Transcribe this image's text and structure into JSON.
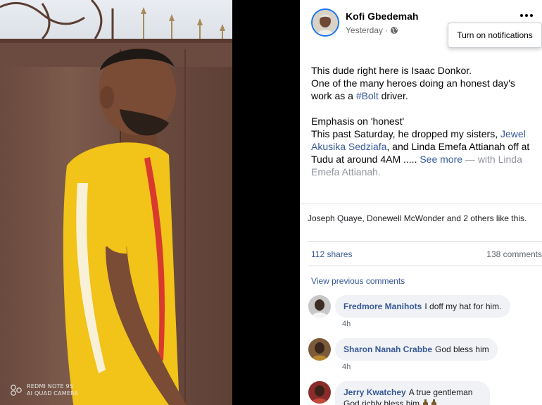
{
  "photo": {
    "watermark_line1": "REDMI NOTE 9S",
    "watermark_line2": "AI QUAD CAMERA"
  },
  "post": {
    "author": "Kofi Gbedemah",
    "time": "Yesterday",
    "audience_icon": "globe-icon",
    "tooltip": "Turn on notifications",
    "text_line1": "This dude right here is Isaac Donkor.",
    "text_line2_a": "One of the many heroes doing an honest day's work as a ",
    "hashtag": "#Bolt",
    "text_line2_b": " driver.",
    "text_line3": "Emphasis on 'honest'",
    "text_line4_a": "This past Saturday, he dropped my sisters, ",
    "tag1": "Jewel Akusika Sedziafa",
    "text_line4_b": ", and Linda Emefa Attianah off at Tudu at around 4AM ..... ",
    "see_more": "See more",
    "with_text": " — with Linda Emefa Attianah."
  },
  "reactions": {
    "likes_text": "Joseph Quaye, Donewell McWonder and 2 others like this.",
    "shares": "112 shares",
    "comments": "138 comments",
    "view_previous": "View previous comments"
  },
  "comments": [
    {
      "name": "Fredmore Manihots",
      "text": "I doff my hat for him.",
      "time": "4h"
    },
    {
      "name": "Sharon Nanah Crabbe",
      "text": "God bless him",
      "time": "4h"
    },
    {
      "name": "Jerry Kwatchey",
      "text": "A true gentleman",
      "text2": "God richly bless him",
      "time": ""
    }
  ],
  "colors": {
    "accent": "#1877f2",
    "link": "#385898",
    "muted": "#65676b",
    "bubble": "#f0f2f5"
  }
}
